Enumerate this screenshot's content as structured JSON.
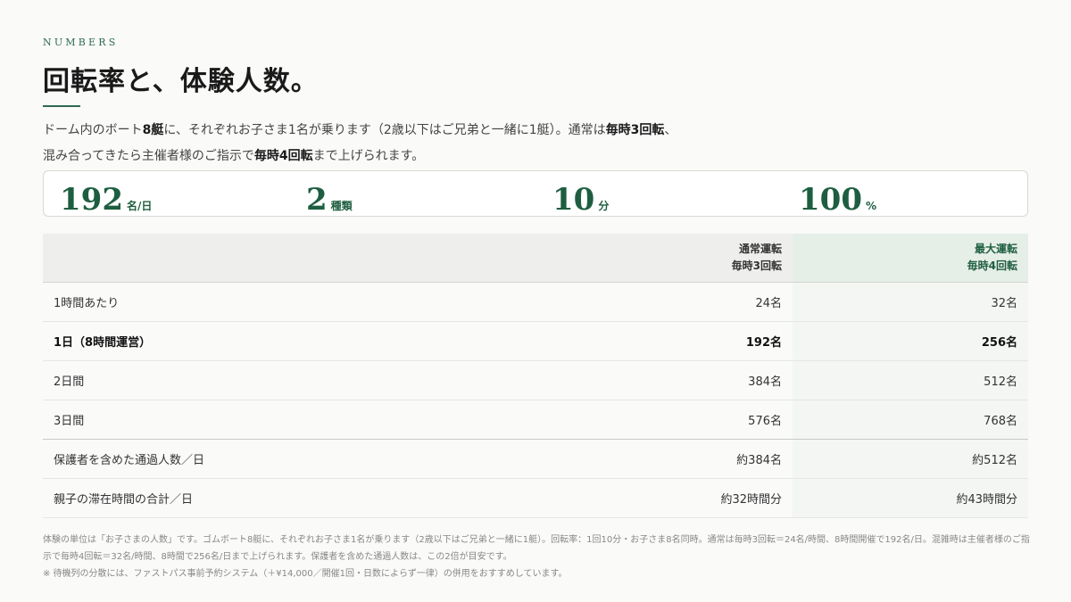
{
  "eyebrow": "NUMBERS",
  "title": "回転率と、体験人数。",
  "lead": {
    "p1": "ドーム内のボート",
    "b1": "8艇",
    "p2": "に、それぞれお子さま1名が乗ります（2歳以下はご兄弟と一緒に1艇）。通常は",
    "b2": "毎時3回転",
    "p3": "、混み合ってきたら主催者様のご指示で",
    "b3": "毎時4回転",
    "p4": "まで上げられます。"
  },
  "stats": [
    {
      "value": "192",
      "unit": "名/日"
    },
    {
      "value": "2",
      "unit": "種類"
    },
    {
      "value": "10",
      "unit": "分"
    },
    {
      "value": "100",
      "unit": "%"
    }
  ],
  "table": {
    "header": {
      "a_line1": "通常運転",
      "a_line2": "毎時3回転",
      "b_line1": "最大運転",
      "b_line2": "毎時4回転"
    },
    "rows": [
      {
        "label": "1時間あたり",
        "a": "24名",
        "b": "32名"
      },
      {
        "label": "1日（8時間運営）",
        "a": "192名",
        "b": "256名"
      },
      {
        "label": "2日間",
        "a": "384名",
        "b": "512名"
      },
      {
        "label": "3日間",
        "a": "576名",
        "b": "768名"
      },
      {
        "label": "保護者を含めた通過人数／日",
        "a": "約384名",
        "b": "約512名"
      },
      {
        "label": "親子の滞在時間の合計／日",
        "a": "約32時間分",
        "b": "約43時間分"
      }
    ]
  },
  "notes": {
    "line1": "体験の単位は「お子さまの人数」です。ゴムボート8艇に、それぞれお子さま1名が乗ります（2歳以下はご兄弟と一緒に1艇）。回転率：1回10分・お子さま8名同時。通常は毎時3回転＝24名/時間、8時間開催で192名/日。混雑時は主催者様のご指示で毎時4回転＝32名/時間、8時間で256名/日まで上げられます。保護者を含めた通過人数は、この2倍が目安です。",
    "line2": "※ 待機列の分散には、ファストパス事前予約システム（＋¥14,000／開催1回・日数によらず一律）の併用をおすすめしています。"
  }
}
